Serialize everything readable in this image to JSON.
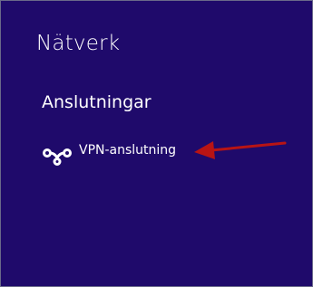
{
  "pane": {
    "title": "Nätverk",
    "background_color": "#1f0a6b"
  },
  "connections": {
    "heading": "Anslutningar",
    "items": [
      {
        "label": "VPN-anslutning",
        "icon": "vpn-icon"
      }
    ]
  },
  "annotation": {
    "arrow_color": "#b81414",
    "arrow_direction": "left"
  }
}
